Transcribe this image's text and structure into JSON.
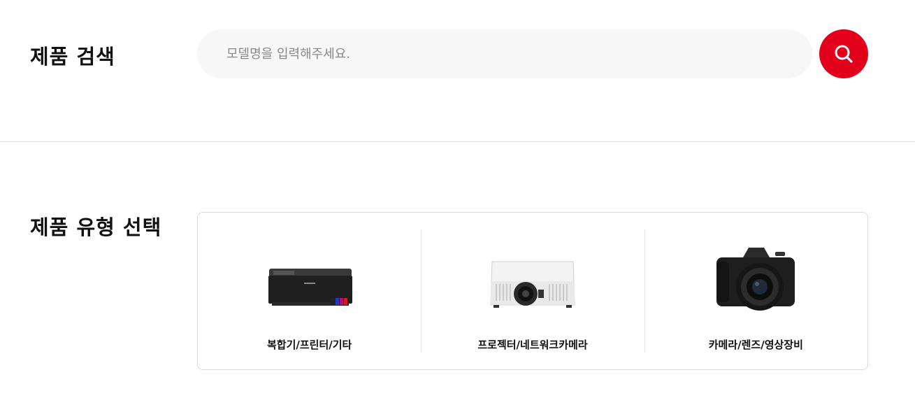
{
  "search": {
    "title": "제품 검색",
    "placeholder": "모델명을 입력해주세요.",
    "value": "",
    "button_icon": "search-icon",
    "accent_color": "#e2001a"
  },
  "product_types": {
    "title": "제품 유형 선택",
    "items": [
      {
        "label": "복합기/프린터/기타",
        "icon": "printer-icon"
      },
      {
        "label": "프로젝터/네트워크카메라",
        "icon": "projector-icon"
      },
      {
        "label": "카메라/렌즈/영상장비",
        "icon": "camera-icon"
      }
    ]
  }
}
